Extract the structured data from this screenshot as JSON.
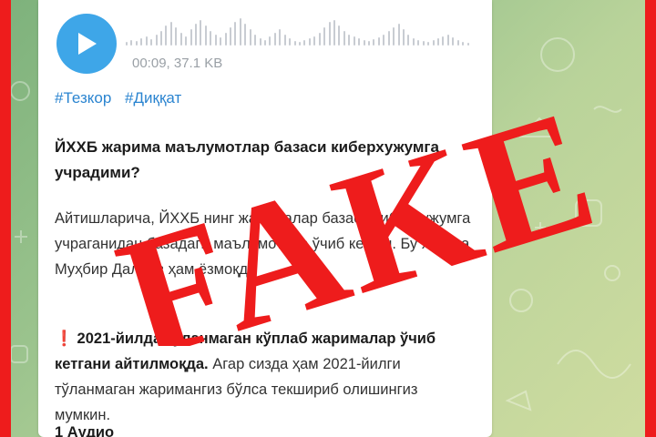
{
  "audio": {
    "duration_size": "00:09, 37.1 KB"
  },
  "hashtags": [
    "#Тезкор",
    "#Диққат"
  ],
  "post": {
    "title": "ЙХХБ жарима маълумотлар базаси киберхужумга учрадими?",
    "body": "Айтишларича, ЙХХБ нинг жарималар базаси киберхужумга учраганидан базадаги маълумотлар ўчиб кетган. Бу хақида Муҳбир Далиев ҳам ёзмоқда",
    "highlight_bold": "2021-йилда тўланмаган кўплаб жарималар ўчиб кетгани айтилмоқда.",
    "highlight_rest": " Агар сизда ҳам 2021-йилги тўланмаган жаримангиз бўлса текшириб олишингиз мумкин.",
    "footer": "1 Аудио"
  },
  "stamp": {
    "text": "FAKE",
    "color": "#ee1c1c"
  },
  "colors": {
    "frame": "#ee1c1c",
    "play_button": "#3ea6e8",
    "hashtag": "#2a84d0"
  },
  "icons": {
    "play": "play-icon",
    "warning": "exclamation-icon"
  }
}
